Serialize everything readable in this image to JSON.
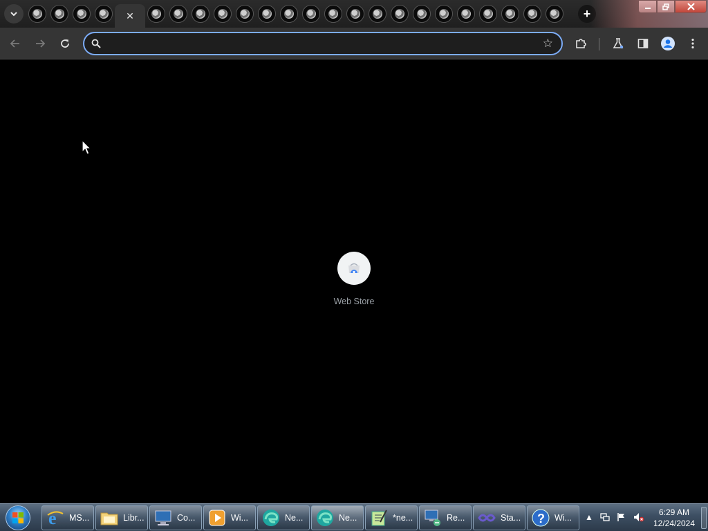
{
  "browser": {
    "tab_count": 24,
    "active_tab_index": 4,
    "new_tab_label": "+",
    "omnibox": {
      "value": "",
      "placeholder": ""
    },
    "accent_color": "#7cacf8"
  },
  "content": {
    "shortcuts": [
      {
        "label": "Web Store",
        "icon": "web-store-icon"
      }
    ]
  },
  "taskbar": {
    "items": [
      {
        "label": "MS...",
        "icon": "ie-icon",
        "active": false
      },
      {
        "label": "Libr...",
        "icon": "libraries-folder-icon",
        "active": false
      },
      {
        "label": "Co...",
        "icon": "computer-icon",
        "active": false
      },
      {
        "label": "Wi...",
        "icon": "media-player-icon",
        "active": false
      },
      {
        "label": "Ne...",
        "icon": "edge-icon",
        "active": false
      },
      {
        "label": "Ne...",
        "icon": "edge-icon",
        "active": true
      },
      {
        "label": "*ne...",
        "icon": "notepad-icon",
        "active": false
      },
      {
        "label": "Re...",
        "icon": "remote-desktop-icon",
        "active": false
      },
      {
        "label": "Sta...",
        "icon": "visual-studio-icon",
        "active": false
      },
      {
        "label": "Wi...",
        "icon": "help-icon",
        "active": false
      }
    ],
    "clock": {
      "time": "6:29 AM",
      "date": "12/24/2024"
    }
  }
}
